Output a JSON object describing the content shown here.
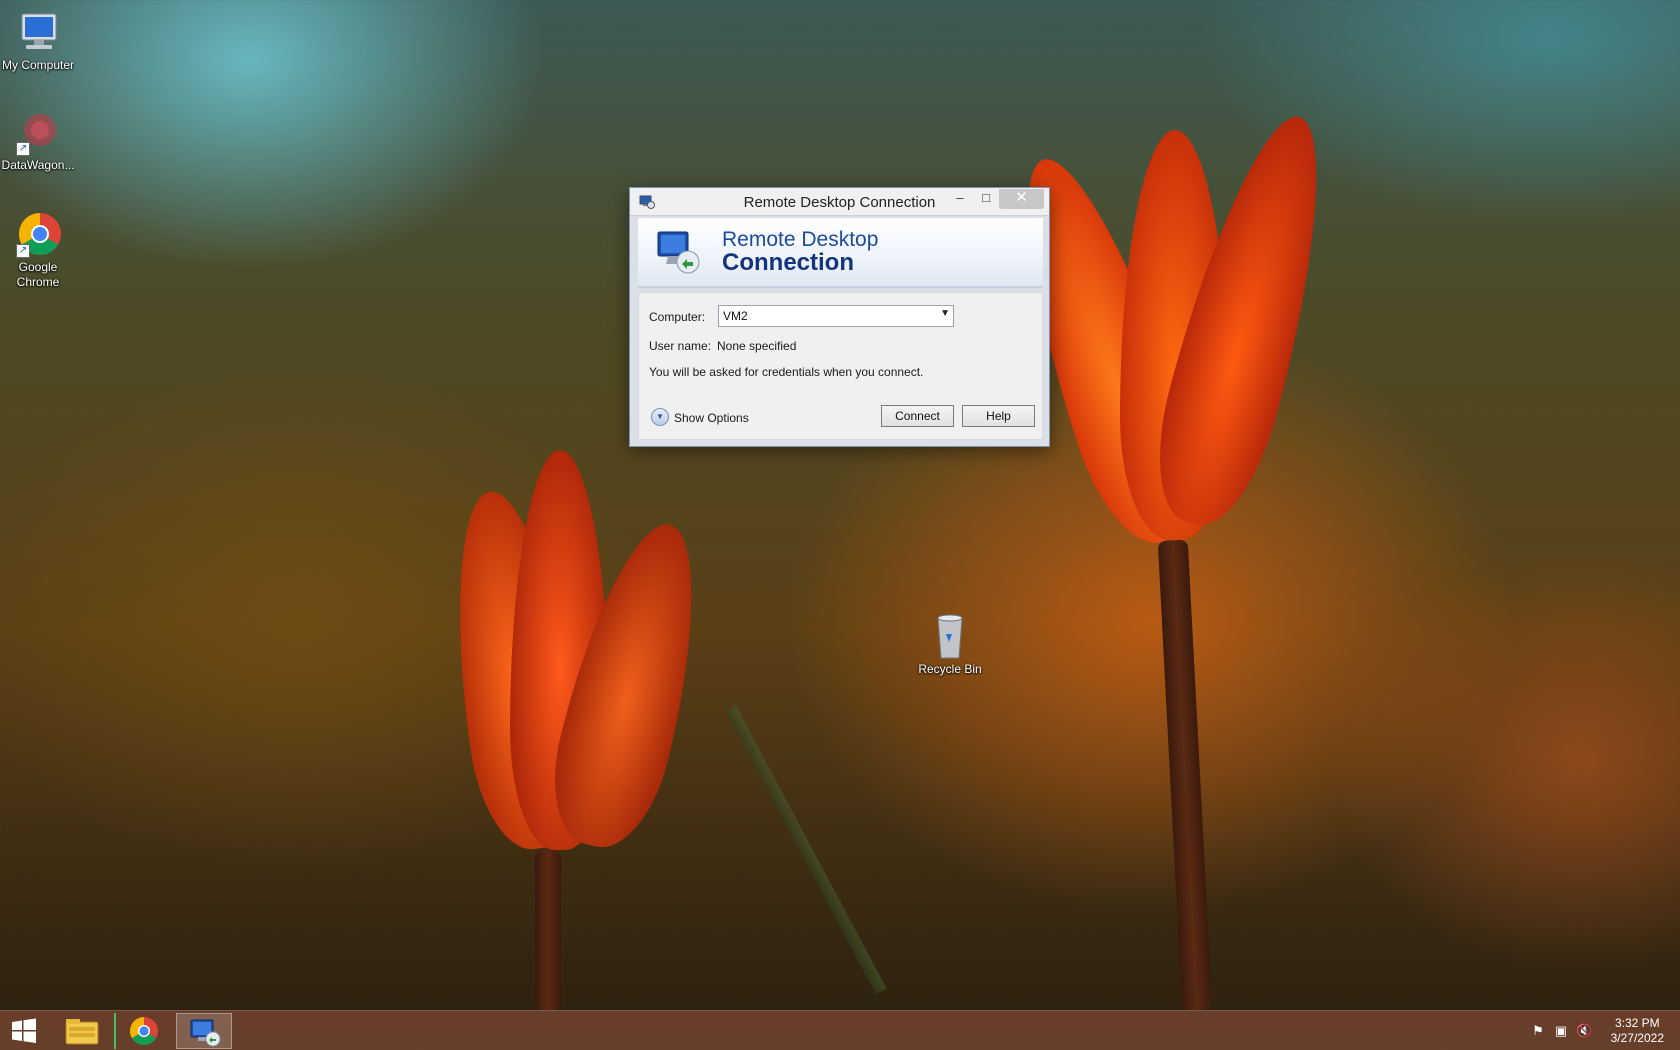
{
  "desktop": {
    "icons": [
      {
        "label": "My Computer"
      },
      {
        "label": "DataWagon..."
      },
      {
        "label": "Google Chrome"
      },
      {
        "label": "Recycle Bin"
      }
    ]
  },
  "window": {
    "title": "Remote Desktop Connection",
    "banner_line1": "Remote Desktop",
    "banner_line2": "Connection",
    "computer_label": "Computer:",
    "computer_value": "VM2",
    "username_label": "User name:",
    "username_value": "None specified",
    "credentials_note": "You will be asked for credentials when you connect.",
    "show_options_label": "Show Options",
    "connect_label": "Connect",
    "help_label": "Help",
    "minimize_glyph": "–",
    "maximize_glyph": "□",
    "close_glyph": "✕"
  },
  "taskbar": {
    "items": [
      {
        "icon": "windows-start-icon"
      },
      {
        "icon": "file-explorer-icon"
      },
      {
        "icon": "chrome-icon"
      },
      {
        "icon": "remote-desktop-icon"
      }
    ],
    "tray": [
      {
        "icon": "action-center-flag-icon"
      },
      {
        "icon": "network-icon"
      },
      {
        "icon": "volume-muted-icon"
      }
    ],
    "time": "3:32 PM",
    "date": "3/27/2022"
  }
}
